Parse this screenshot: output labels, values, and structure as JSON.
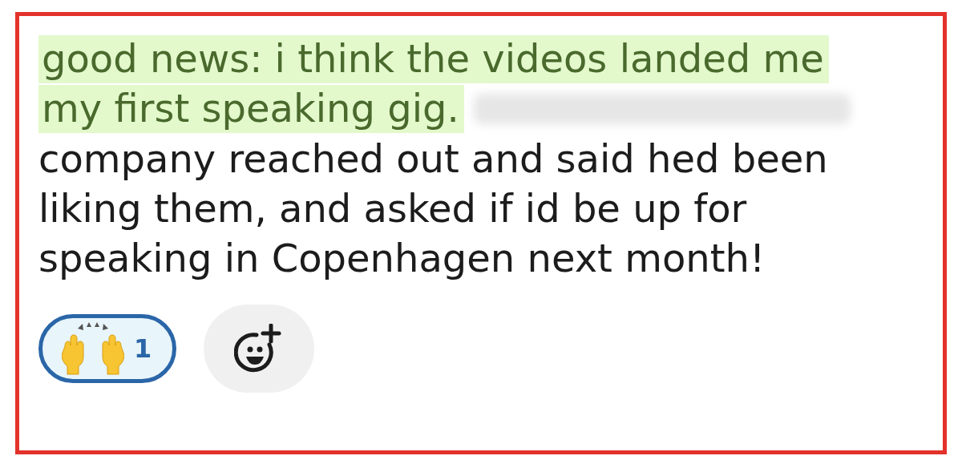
{
  "message": {
    "highlighted_lines": [
      "good news: i think the videos landed me",
      "my first speaking gig."
    ],
    "redacted": true,
    "lines": [
      "company reached out and said hed been",
      "liking them, and asked if id be up for",
      "speaking in Copenhagen next month!"
    ]
  },
  "reactions": [
    {
      "count": "1",
      "selected": true
    }
  ]
}
